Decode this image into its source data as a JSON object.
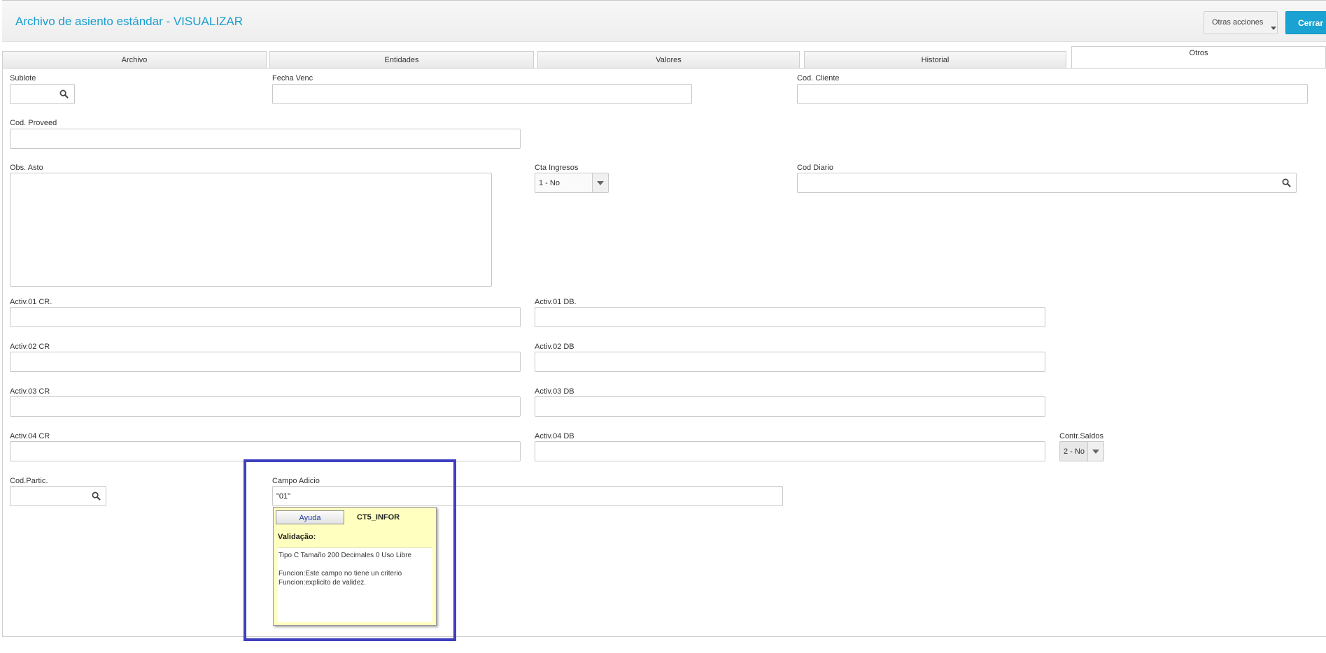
{
  "header": {
    "title": "Archivo de asiento estándar - VISUALIZAR",
    "other_actions_label": "Otras acciones",
    "close_label": "Cerrar"
  },
  "tabs": [
    {
      "label": "Archivo"
    },
    {
      "label": "Entidades"
    },
    {
      "label": "Valores"
    },
    {
      "label": "Historial"
    },
    {
      "label": "Otros",
      "active": true
    }
  ],
  "form": {
    "sublote": {
      "label": "Sublote",
      "value": ""
    },
    "fecha_venc": {
      "label": "Fecha Venc",
      "value": ""
    },
    "cod_cliente": {
      "label": "Cod. Cliente",
      "value": ""
    },
    "cod_proveed": {
      "label": "Cod. Proveed",
      "value": ""
    },
    "obs_asto": {
      "label": "Obs. Asto",
      "value": ""
    },
    "cta_ingresos": {
      "label": "Cta Ingresos",
      "value": "1 - No"
    },
    "cod_diario": {
      "label": "Cod Diario",
      "value": ""
    },
    "activ01_cr": {
      "label": "Activ.01 CR.",
      "value": ""
    },
    "activ01_db": {
      "label": "Activ.01 DB.",
      "value": ""
    },
    "activ02_cr": {
      "label": "Activ.02 CR",
      "value": ""
    },
    "activ02_db": {
      "label": "Activ.02 DB",
      "value": ""
    },
    "activ03_cr": {
      "label": "Activ.03 CR",
      "value": ""
    },
    "activ03_db": {
      "label": "Activ.03 DB",
      "value": ""
    },
    "activ04_cr": {
      "label": "Activ.04 CR",
      "value": ""
    },
    "activ04_db": {
      "label": "Activ.04 DB",
      "value": ""
    },
    "contr_saldos": {
      "label": "Contr.Saldos",
      "value": "2 - No"
    },
    "cod_partic": {
      "label": "Cod.Partic.",
      "value": ""
    },
    "campo_adicio": {
      "label": "Campo Adicio",
      "value": "\"01\""
    }
  },
  "tooltip": {
    "help_button": "Ayuda",
    "field_code": "CT5_INFOR",
    "validation_title": "Validação:",
    "line1": "Tipo C Tamaño 200 Decimales 0  Uso Libre",
    "line2": "Funcion:Este campo no tiene un criterio",
    "line3": "Funcion:explicito de validez."
  },
  "colors": {
    "title": "#1a9ecf",
    "primary_button": "#1aa3d2",
    "highlight_border": "#3f3fbf",
    "tooltip_bg": "#ffffc0"
  }
}
